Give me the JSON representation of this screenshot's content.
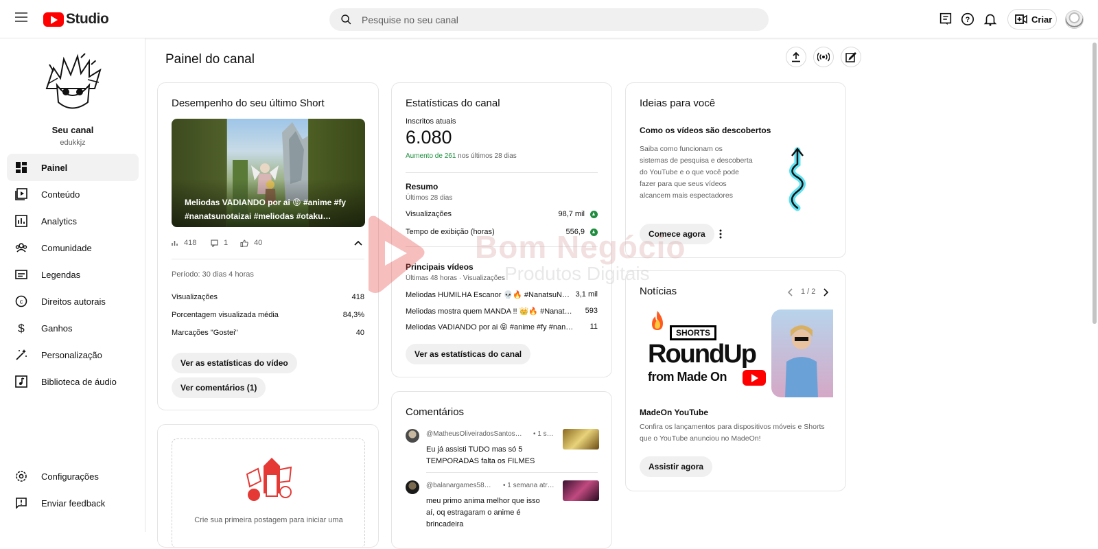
{
  "app": {
    "logo_text": "Studio"
  },
  "search": {
    "placeholder": "Pesquise no seu canal"
  },
  "topbar": {
    "create_label": "Criar"
  },
  "channel": {
    "name": "Seu canal",
    "handle": "edukkjz"
  },
  "nav": [
    {
      "label": "Painel",
      "icon": "dashboard-icon",
      "active": true
    },
    {
      "label": "Conteúdo",
      "icon": "content-icon"
    },
    {
      "label": "Analytics",
      "icon": "analytics-icon"
    },
    {
      "label": "Comunidade",
      "icon": "community-icon"
    },
    {
      "label": "Legendas",
      "icon": "subtitles-icon"
    },
    {
      "label": "Direitos autorais",
      "icon": "copyright-icon"
    },
    {
      "label": "Ganhos",
      "icon": "earn-icon"
    },
    {
      "label": "Personalização",
      "icon": "customization-icon"
    },
    {
      "label": "Biblioteca de áudio",
      "icon": "audio-library-icon"
    }
  ],
  "nav_bottom": [
    {
      "label": "Configurações",
      "icon": "settings-icon"
    },
    {
      "label": "Enviar feedback",
      "icon": "feedback-icon"
    }
  ],
  "page": {
    "title": "Painel do canal"
  },
  "short_card": {
    "title": "Desempenho do seu último Short",
    "caption": "Meliodas VADIANDO por ai 😝 #anime #fy #nanatsunotaizai #meliodas #otaku…",
    "views": "418",
    "comments": "1",
    "likes": "40",
    "period": "Período: 30 dias 4 horas",
    "stats": [
      {
        "label": "Visualizações",
        "value": "418"
      },
      {
        "label": "Porcentagem visualizada média",
        "value": "84,3%"
      },
      {
        "label": "Marcações \"Gostei\"",
        "value": "40"
      }
    ],
    "btn_stats": "Ver as estatísticas do vídeo",
    "btn_comments": "Ver comentários (1)"
  },
  "post_card": {
    "text": "Crie sua primeira postagem para iniciar uma"
  },
  "channel_stats": {
    "title": "Estatísticas do canal",
    "subs_label": "Inscritos atuais",
    "subs_value": "6.080",
    "increase_green": "Aumento de 261",
    "increase_rest": "nos últimos 28 dias",
    "summary_title": "Resumo",
    "summary_period": "Últimos 28 dias",
    "summary": [
      {
        "label": "Visualizações",
        "value": "98,7 mil"
      },
      {
        "label": "Tempo de exibição (horas)",
        "value": "556,9"
      }
    ],
    "top_title": "Principais vídeos",
    "top_period": "Últimas 48 horas · Visualizações",
    "top_videos": [
      {
        "title": "Meliodas HUMILHA Escanor 💀🔥 #NanatsuNoTaizai",
        "value": "3,1 mil"
      },
      {
        "title": "Meliodas mostra quem MANDA !! 👑🔥 #Nanatsu…",
        "value": "593"
      },
      {
        "title": "Meliodas VADIANDO por ai 😝 #anime #fy #nana…",
        "value": "11"
      }
    ],
    "btn": "Ver as estatísticas do canal"
  },
  "comments": {
    "title": "Comentários",
    "items": [
      {
        "author": "@MatheusOliveiradosSantos…",
        "time": "• 1 s…",
        "text": "Eu já assisti TUDO mas só 5 TEMPORADAS falta os FILMES"
      },
      {
        "author": "@balanargames58…",
        "time": "• 1 semana atr…",
        "text": "meu primo anima melhor que isso aí, oq estragaram o anime é brincadeira"
      }
    ]
  },
  "ideas": {
    "title": "Ideias para você",
    "subtitle": "Como os vídeos são descobertos",
    "text": "Saiba como funcionam os sistemas de pesquisa e descoberta do YouTube e o que você pode fazer para que seus vídeos alcancem mais espectadores",
    "btn": "Comece agora"
  },
  "news": {
    "title": "Notícias",
    "pager": "1 / 2",
    "img_badge": "SHORTS",
    "img_line1": "RoundUp",
    "img_line2": "from Made On",
    "headline": "MadeOn YouTube",
    "text": "Confira os lançamentos para dispositivos móveis e Shorts que o YouTube anunciou no MadeOn!",
    "btn": "Assistir agora"
  },
  "watermark": {
    "line1": "Bom Negócio",
    "line2": "Produtos Digitais"
  },
  "colors": {
    "brand_red": "#ff0000",
    "green": "#1e8e3e"
  }
}
